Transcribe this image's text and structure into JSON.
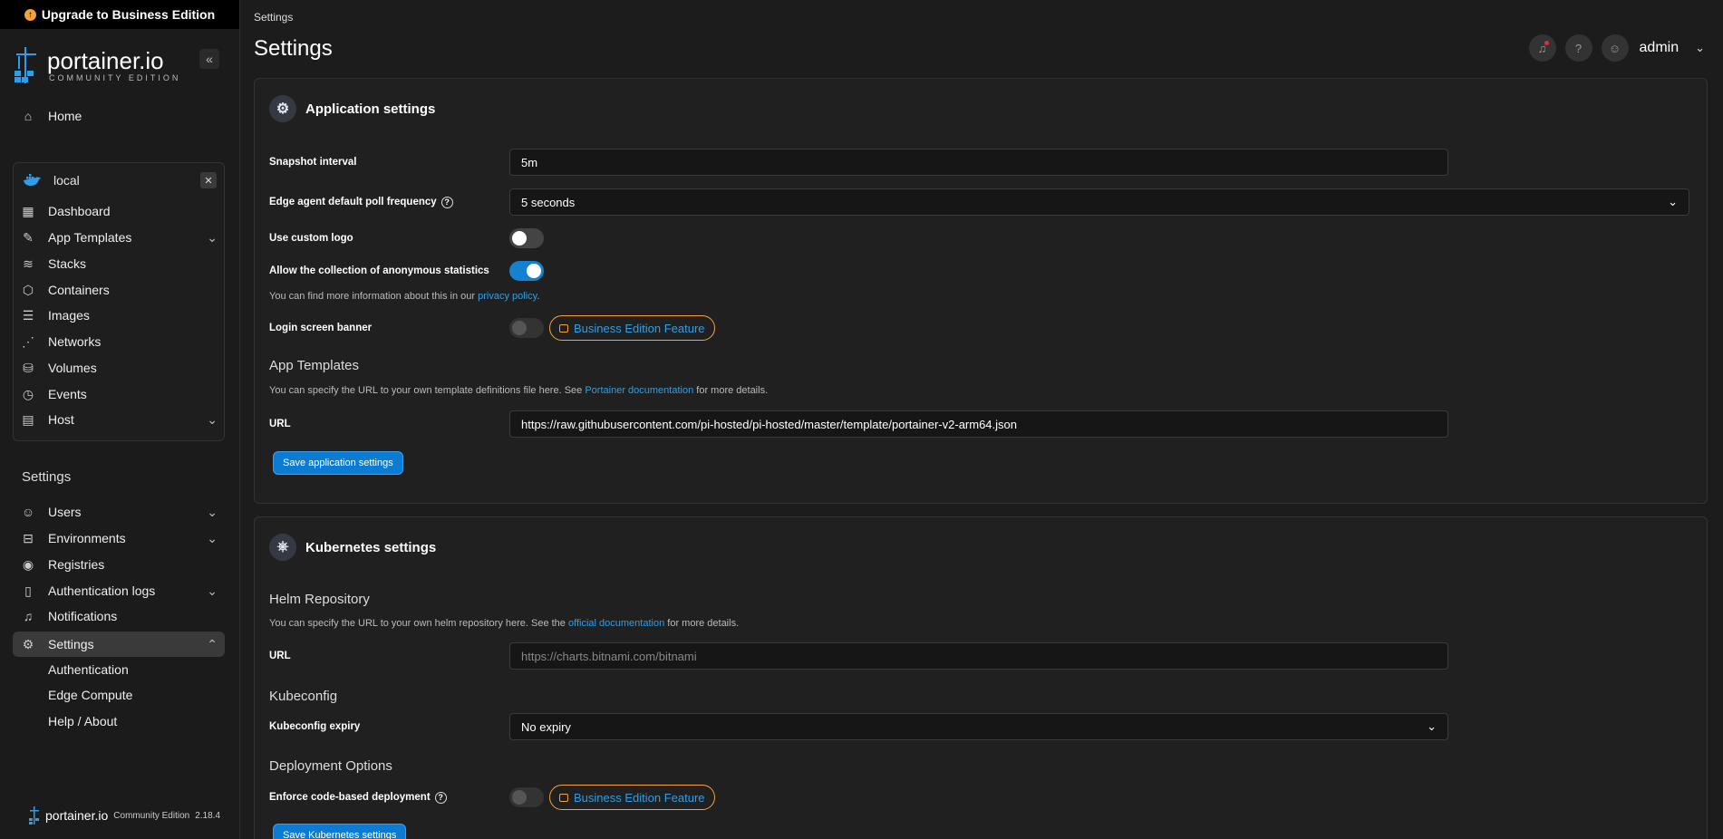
{
  "upgrade": {
    "label": "Upgrade to Business Edition"
  },
  "brand": {
    "name": "portainer.io",
    "edition": "COMMUNITY EDITION"
  },
  "sidebar": {
    "home": "Home",
    "environment": {
      "name": "local"
    },
    "env_items": [
      {
        "label": "Dashboard"
      },
      {
        "label": "App Templates"
      },
      {
        "label": "Stacks"
      },
      {
        "label": "Containers"
      },
      {
        "label": "Images"
      },
      {
        "label": "Networks"
      },
      {
        "label": "Volumes"
      },
      {
        "label": "Events"
      },
      {
        "label": "Host"
      }
    ],
    "section_title": "Settings",
    "settings_items": [
      {
        "label": "Users"
      },
      {
        "label": "Environments"
      },
      {
        "label": "Registries"
      },
      {
        "label": "Authentication logs"
      },
      {
        "label": "Notifications"
      },
      {
        "label": "Settings"
      }
    ],
    "settings_sub": [
      {
        "label": "Authentication"
      },
      {
        "label": "Edge Compute"
      },
      {
        "label": "Help / About"
      }
    ],
    "footer": {
      "brand": "portainer.io",
      "edition": "Community Edition",
      "version": "2.18.4"
    }
  },
  "header": {
    "breadcrumb": "Settings",
    "title": "Settings",
    "user": "admin"
  },
  "app_settings": {
    "title": "Application settings",
    "snapshot_label": "Snapshot interval",
    "snapshot_value": "5m",
    "poll_label": "Edge agent default poll frequency",
    "poll_value": "5 seconds",
    "custom_logo_label": "Use custom logo",
    "custom_logo_enabled": false,
    "stats_label": "Allow the collection of anonymous statistics",
    "stats_enabled": true,
    "stats_help_prefix": "You can find more information about this in our",
    "stats_help_link": "privacy policy",
    "stats_help_suffix": ".",
    "banner_label": "Login screen banner",
    "be_feature": "Business Edition Feature",
    "templates_title": "App Templates",
    "templates_help_prefix": "You can specify the URL to your own template definitions file here. See",
    "templates_help_link": "Portainer documentation",
    "templates_help_suffix": "for more details.",
    "url_label": "URL",
    "url_value": "https://raw.githubusercontent.com/pi-hosted/pi-hosted/master/template/portainer-v2-arm64.json",
    "save_label": "Save application settings"
  },
  "k8s_settings": {
    "title": "Kubernetes settings",
    "helm_title": "Helm Repository",
    "helm_help_prefix": "You can specify the URL to your own helm repository here. See the",
    "helm_help_link": "official documentation",
    "helm_help_suffix": "for more details.",
    "url_label": "URL",
    "url_placeholder": "https://charts.bitnami.com/bitnami",
    "kubeconfig_title": "Kubeconfig",
    "expiry_label": "Kubeconfig expiry",
    "expiry_value": "No expiry",
    "deploy_title": "Deployment Options",
    "enforce_label": "Enforce code-based deployment",
    "be_feature": "Business Edition Feature",
    "save_label": "Save Kubernetes settings"
  },
  "colors": {
    "accent": "#0b7cd2",
    "link": "#2f9ee8",
    "be_border": "#f5a142"
  }
}
